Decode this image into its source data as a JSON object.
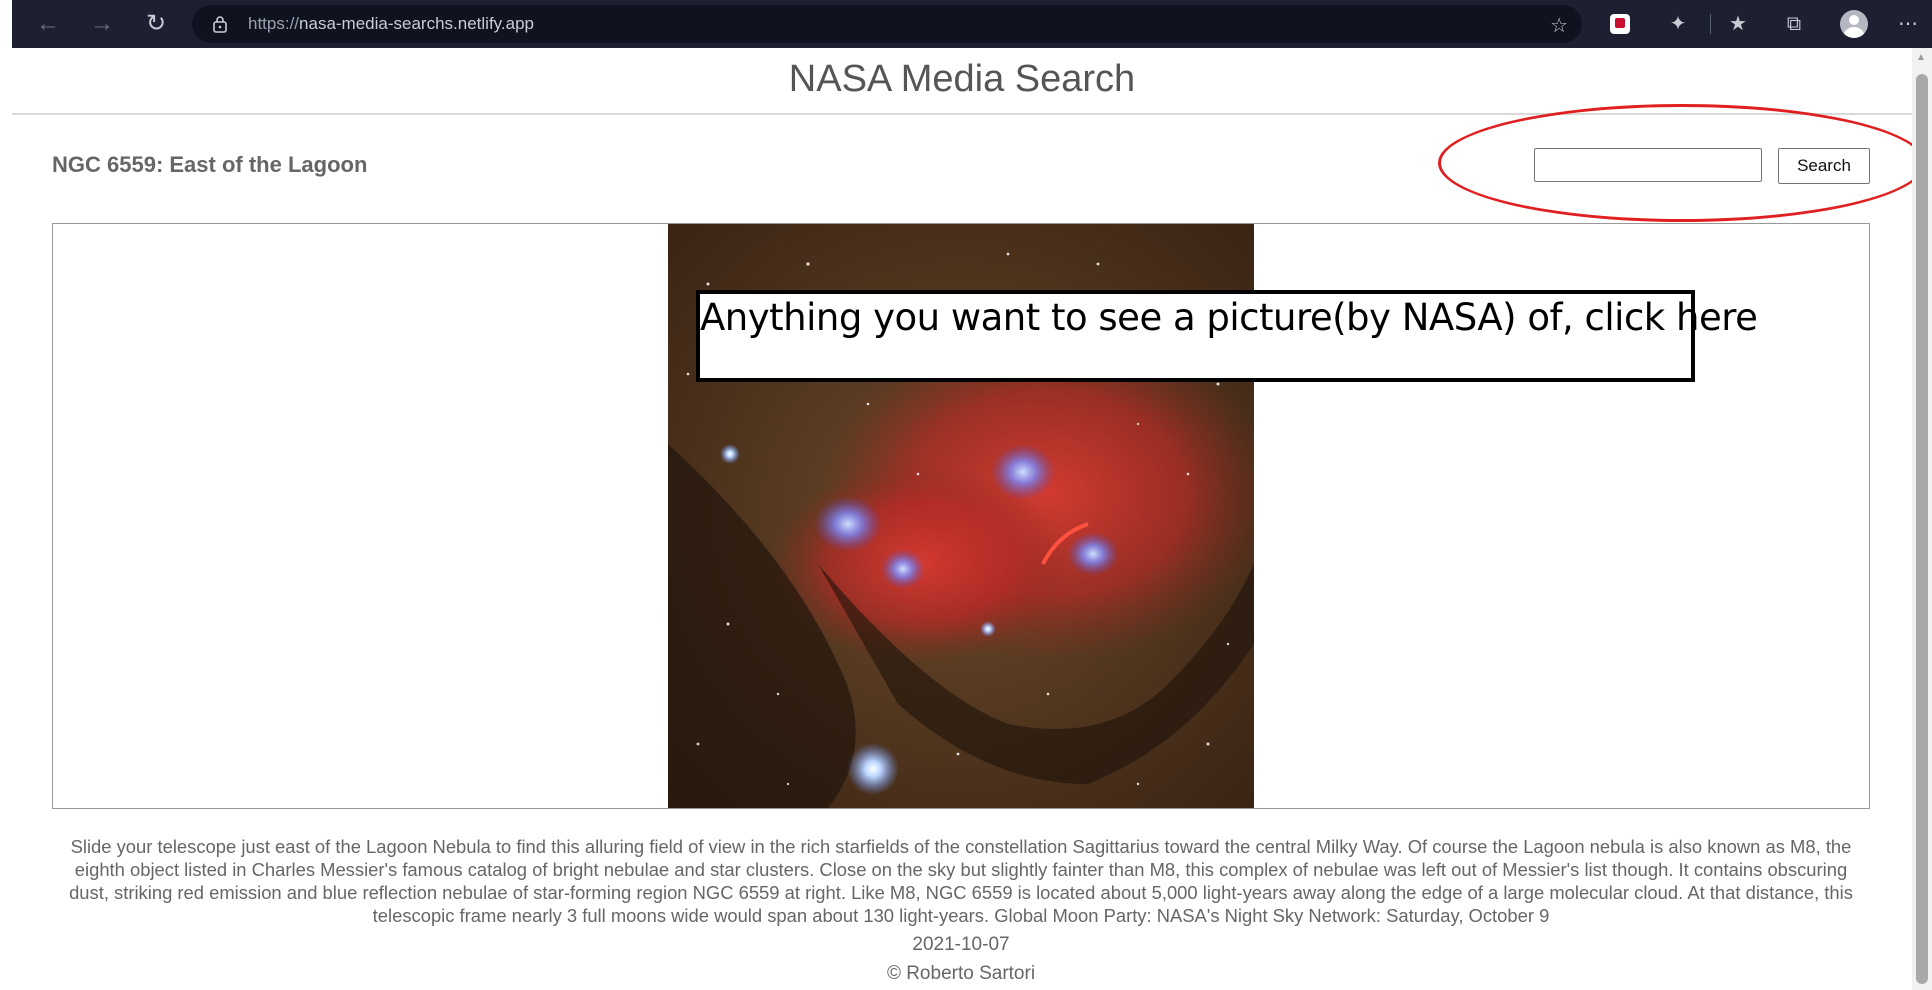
{
  "browser": {
    "url_scheme": "https://",
    "url_host": "nasa-media-searchs.netlify.app",
    "icons": [
      "back-icon",
      "forward-icon",
      "refresh-icon",
      "lock-icon",
      "add-favorite-icon",
      "extension-icon",
      "puzzle-icon",
      "favorites-icon",
      "collections-icon",
      "profile-icon",
      "more-icon"
    ]
  },
  "page": {
    "title": "NASA Media Search",
    "image_title": "NGC 6559: East of the Lagoon",
    "search": {
      "value": "",
      "placeholder": "",
      "button_label": "Search"
    },
    "annotation_text": "Anything you want to see a picture(by NASA) of, click here",
    "description": "Slide your telescope just east of the Lagoon Nebula to find this alluring field of view in the rich starfields of the constellation Sagittarius toward the central Milky Way. Of course the Lagoon nebula is also known as M8, the eighth object listed in Charles Messier's famous catalog of bright nebulae and star clusters. Close on the sky but slightly fainter than M8, this complex of nebulae was left out of Messier's list though. It contains obscuring dust, striking red emission and blue reflection nebulae of star-forming region NGC 6559 at right. Like M8, NGC 6559 is located about 5,000 light-years away along the edge of a large molecular cloud. At that distance, this telescopic frame nearly 3 full moons wide would span about 130 light-years. Global Moon Party: NASA's Night Sky Network: Saturday, October 9",
    "date": "2021-10-07",
    "credit": "© Roberto Sartori"
  },
  "colors": {
    "chrome_bg": "#1c2030",
    "callout_red": "#e02020",
    "title_gray": "#555555"
  }
}
